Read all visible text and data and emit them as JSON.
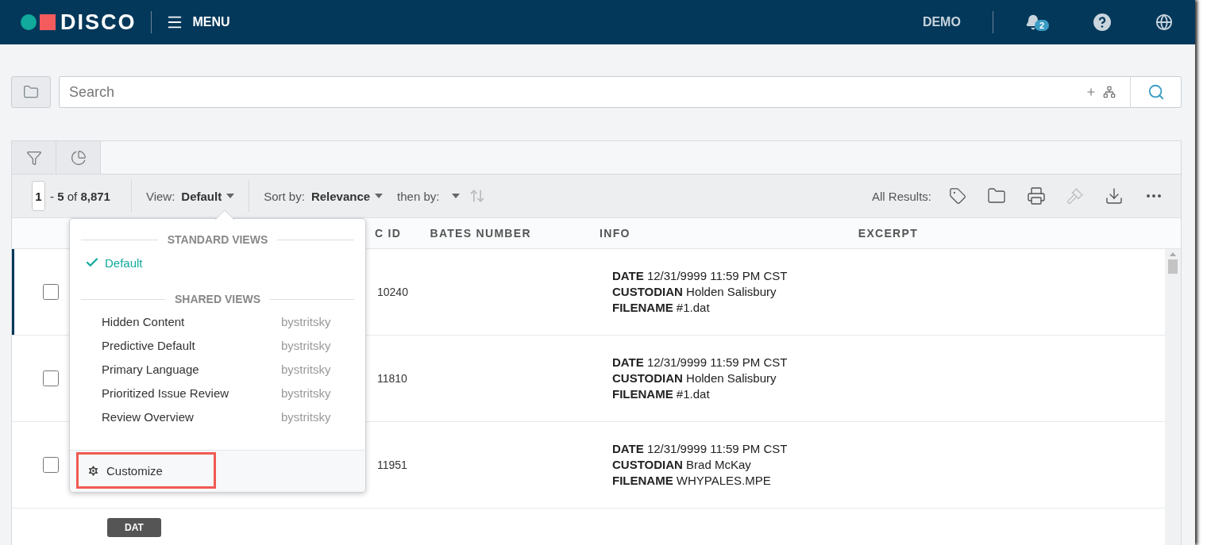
{
  "header": {
    "logo": "DISCO",
    "menu": "MENU",
    "workspace": "DEMO",
    "notifications": "2"
  },
  "search": {
    "placeholder": "Search"
  },
  "toolbar": {
    "page": "1",
    "range": "- **5** of **8,871**",
    "view_label": "View:",
    "view_value": "Default",
    "sort_label": "Sort by:",
    "sort_value": "Relevance",
    "then_label": "then by:",
    "all_results": "All Results:"
  },
  "columns": [
    "C ID",
    "BATES NUMBER",
    "INFO",
    "EXCERPT"
  ],
  "rows": [
    {
      "active": true,
      "checked": false,
      "doc_id": "10240",
      "info": [
        {
          "label": "DATE",
          "value": "12/31/9999 11:59 PM CST"
        },
        {
          "label": "CUSTODIAN",
          "value": "Holden Salisbury"
        },
        {
          "label": "FILENAME",
          "value": "#1.dat"
        }
      ]
    },
    {
      "active": false,
      "checked": false,
      "doc_id": "11810",
      "info": [
        {
          "label": "DATE",
          "value": "12/31/9999 11:59 PM CST"
        },
        {
          "label": "CUSTODIAN",
          "value": "Holden Salisbury"
        },
        {
          "label": "FILENAME",
          "value": "#1.dat"
        }
      ]
    },
    {
      "active": false,
      "checked": false,
      "doc_id": "11951",
      "info": [
        {
          "label": "DATE",
          "value": "12/31/9999 11:59 PM CST"
        },
        {
          "label": "CUSTODIAN",
          "value": "Brad McKay"
        },
        {
          "label": "FILENAME",
          "value": "WHYPALES.MPE"
        }
      ]
    },
    {
      "active": false,
      "badge": "DAT"
    }
  ],
  "view_menu": {
    "sections": [
      {
        "title": "STANDARD VIEWS",
        "items": [
          {
            "label": "Default",
            "selected": true
          }
        ]
      },
      {
        "title": "SHARED VIEWS",
        "items": [
          {
            "label": "Hidden Content",
            "owner": "bystritsky",
            "selected": false
          },
          {
            "label": "Predictive Default",
            "owner": "bystritsky",
            "selected": false
          },
          {
            "label": "Primary Language",
            "owner": "bystritsky",
            "selected": false
          },
          {
            "label": "Prioritized Issue Review",
            "owner": "bystritsky",
            "selected": false
          },
          {
            "label": "Review Overview",
            "owner": "bystritsky",
            "selected": false
          }
        ]
      }
    ],
    "footer": "Customize",
    "footer_highlighted": true
  }
}
